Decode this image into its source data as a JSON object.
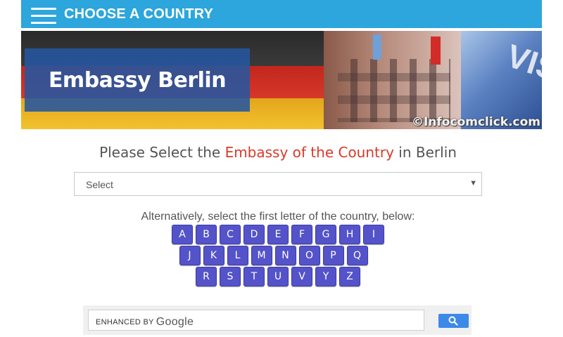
{
  "topbar": {
    "title": "CHOOSE A COUNTRY"
  },
  "banner": {
    "title": "Embassy Berlin",
    "watermark": "©Infocomclick.com"
  },
  "heading": {
    "pre": "Please Select the ",
    "accent": "Embassy of the Country",
    "post": " in Berlin"
  },
  "select": {
    "value": "Select"
  },
  "alt_text": "Alternatively, select the first letter of the country, below:",
  "letters": {
    "row1": [
      "A",
      "B",
      "C",
      "D",
      "E",
      "F",
      "G",
      "H",
      "I"
    ],
    "row2": [
      "J",
      "K",
      "L",
      "M",
      "N",
      "O",
      "P",
      "Q"
    ],
    "row3": [
      "R",
      "S",
      "T",
      "U",
      "V",
      "Y",
      "Z"
    ]
  },
  "search": {
    "enhanced_by": "ENHANCED BY",
    "brand": "Google"
  },
  "icons": {
    "menu": "hamburger-menu-icon",
    "dropdown": "chevron-down-icon",
    "search": "search-icon"
  },
  "colors": {
    "topbar": "#2ca6dc",
    "accent": "#d83a2a",
    "letter_button": "#5453c9",
    "search_button": "#3c89e8"
  }
}
